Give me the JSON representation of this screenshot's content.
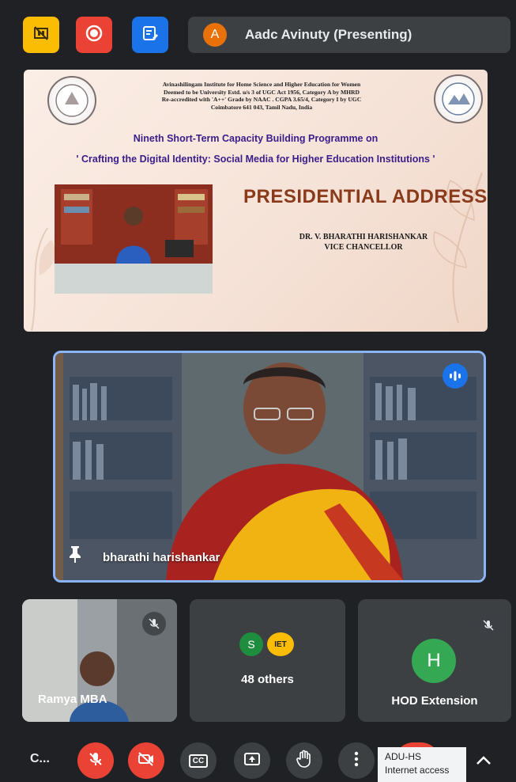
{
  "presenting": {
    "avatar_letter": "A",
    "name": "Aadc Avinuty (Presenting)"
  },
  "slide": {
    "institution_lines": [
      "Avinashilingam Institute for Home Science and Higher Education for Women",
      "Deemed to be University Estd. u/s 3 of UGC Act 1956, Category A by MHRD",
      "Re-accredited with 'A++' Grade by NAAC . CGPA 3.65/4, Category I by UGC",
      "Coimbatore 641 043, Tamil Nadu, India"
    ],
    "programme": "Nineth Short-Term Capacity Building Programme on",
    "theme": "' Crafting the Digital Identity: Social Media for Higher Education Institutions '",
    "heading": "PRESIDENTIAL ADDRESS",
    "speaker_name": "DR. V. BHARATHI HARISHANKAR",
    "speaker_role": "VICE CHANCELLOR"
  },
  "main_tile": {
    "label": "bharathi harishankar"
  },
  "tiles": {
    "ramya": {
      "label": "Ramya MBA"
    },
    "others": {
      "avatar1": "S",
      "avatar2": "IET",
      "label": "48 others"
    },
    "hod": {
      "avatar": "H",
      "label": "HOD Extension"
    }
  },
  "bottom_bar": {
    "meeting_code": "C...",
    "cc_label": "CC",
    "tooltip_line1": "ADU-HS",
    "tooltip_line2": "Internet access"
  },
  "colors": {
    "bg": "#202124",
    "red": "#ea4335",
    "blue_btn": "#1a73e8",
    "yellow_btn": "#fbbc04",
    "active_border": "#8ab4f8",
    "avatar_orange": "#e8710a",
    "hod_green": "#34a853"
  },
  "icons": [
    "no-stop-icon",
    "record-icon",
    "edit-doc-icon",
    "pin-icon",
    "audio-level-icon",
    "mic-off-icon",
    "camera-off-icon",
    "closed-caption-icon",
    "present-screen-icon",
    "raise-hand-icon",
    "more-options-icon",
    "chevron-up-icon"
  ]
}
